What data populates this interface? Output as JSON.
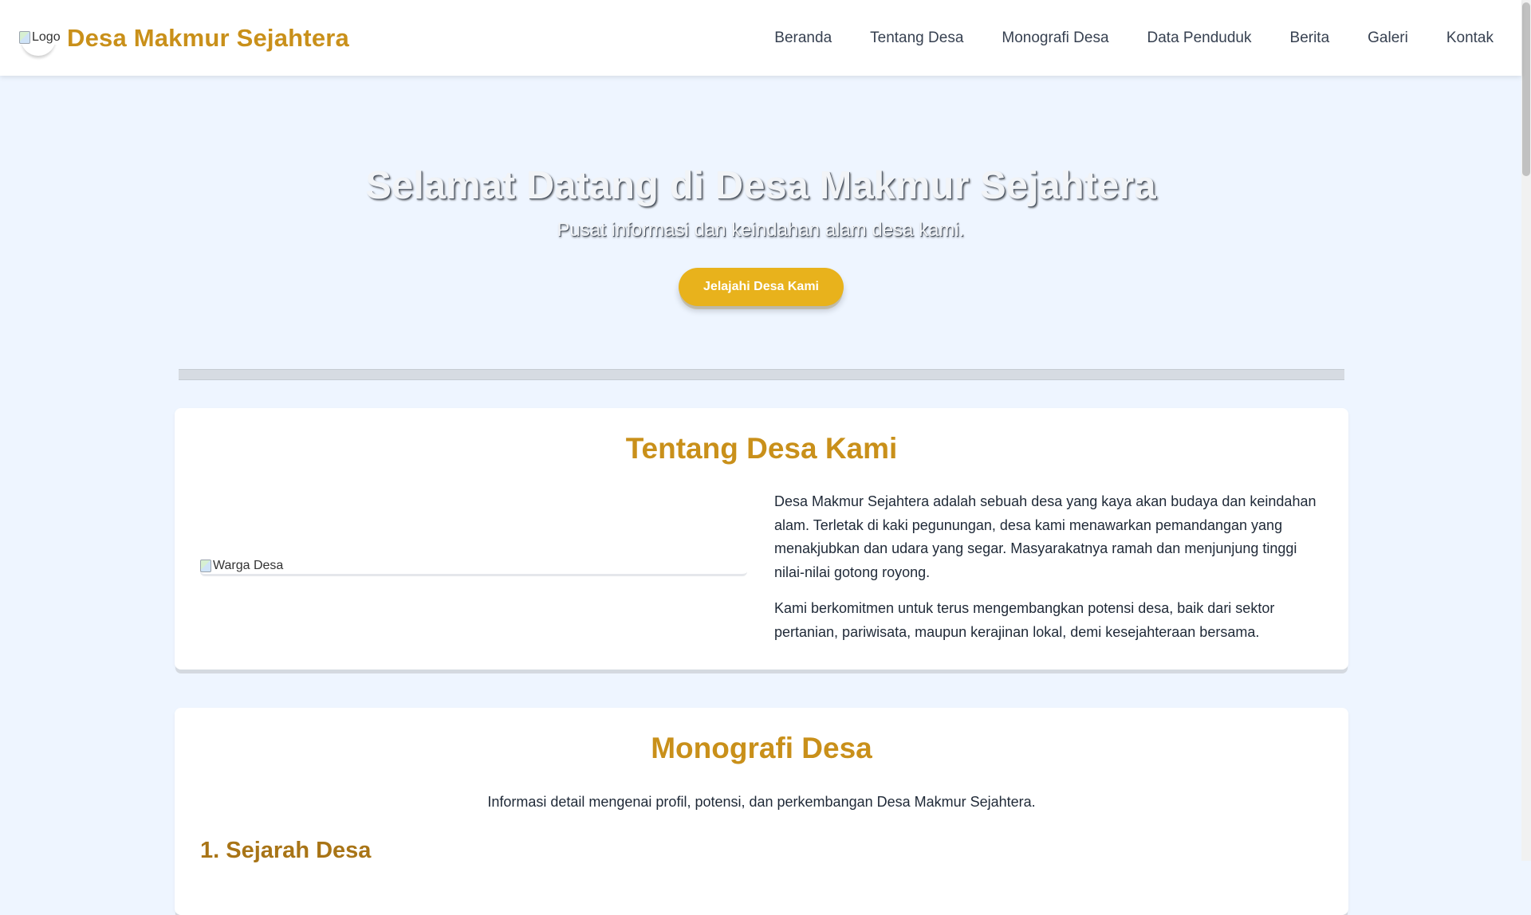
{
  "nav": {
    "logo_alt": "Logo",
    "brand": "Desa Makmur Sejahtera",
    "links": [
      {
        "label": "Beranda"
      },
      {
        "label": "Tentang Desa"
      },
      {
        "label": "Monografi Desa"
      },
      {
        "label": "Data Penduduk"
      },
      {
        "label": "Berita"
      },
      {
        "label": "Galeri"
      },
      {
        "label": "Kontak"
      }
    ]
  },
  "hero": {
    "title": "Selamat Datang di Desa Makmur Sejahtera",
    "subtitle": "Pusat informasi dan keindahan alam desa kami.",
    "cta_label": "Jelajahi Desa Kami"
  },
  "about": {
    "title": "Tentang Desa Kami",
    "image_alt": "Warga Desa",
    "paragraphs": [
      "Desa Makmur Sejahtera adalah sebuah desa yang kaya akan budaya dan keindahan alam. Terletak di kaki pegunungan, desa kami menawarkan pemandangan yang menakjubkan dan udara yang segar. Masyarakatnya ramah dan menjunjung tinggi nilai-nilai gotong royong.",
      "Kami berkomitmen untuk terus mengembangkan potensi desa, baik dari sektor pertanian, pariwisata, maupun kerajinan lokal, demi kesejahteraan bersama."
    ]
  },
  "monografi": {
    "title": "Monografi Desa",
    "description": "Informasi detail mengenai profil, potensi, dan perkembangan Desa Makmur Sejahtera.",
    "section1_title": "1. Sejarah Desa"
  },
  "colors": {
    "accent": "#c9901a",
    "button": "#e8b21c",
    "page_bg": "#eef5ff"
  }
}
